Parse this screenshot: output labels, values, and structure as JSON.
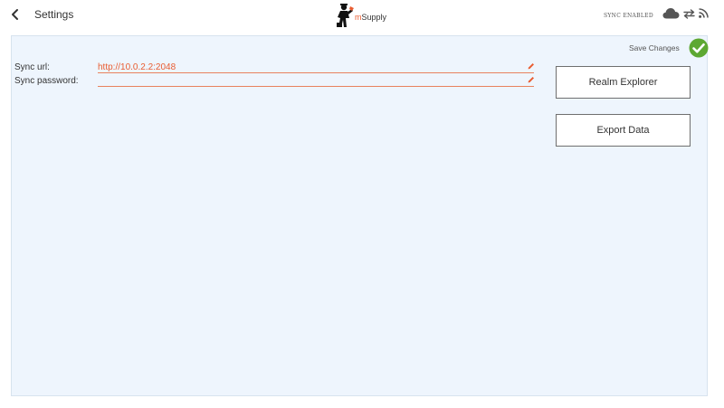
{
  "header": {
    "title": "Settings",
    "logo_m": "m",
    "logo_rest": "Supply",
    "sync_status": "SYNC ENABLED"
  },
  "toolbar": {
    "save_changes_label": "Save Changes"
  },
  "form": {
    "sync_url_label": "Sync url:",
    "sync_url_value": "http://10.0.2.2:2048",
    "sync_password_label": "Sync password:",
    "sync_password_value": ""
  },
  "actions": {
    "realm_explorer_label": "Realm Explorer",
    "export_data_label": "Export Data"
  },
  "colors": {
    "accent": "#e95c30",
    "check_green": "#5da832",
    "panel_background": "#eef5fd"
  }
}
